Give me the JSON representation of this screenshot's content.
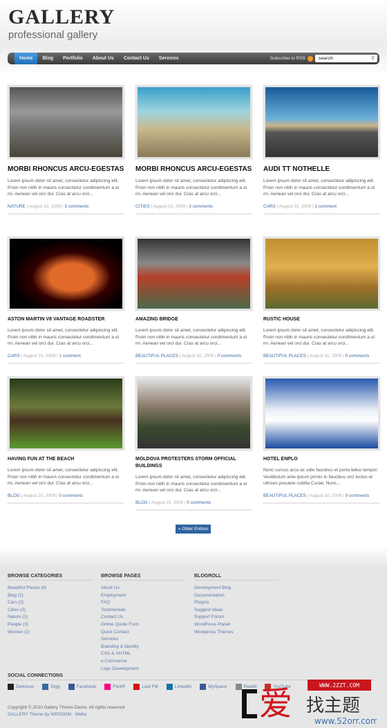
{
  "header": {
    "logo": "GALLERY",
    "tagline": "professional gallery"
  },
  "nav": {
    "items": [
      "Home",
      "Blog",
      "Portfolio",
      "About Us",
      "Contact Us",
      "Services"
    ],
    "active": "Home",
    "subscribe": "Subscribe to RSS",
    "search_placeholder": "search"
  },
  "posts": [
    {
      "title": "MORBI RHONCUS ARCU-EGESTAS",
      "excerpt": "Lorem ipsum dolor sit amet, consectetur adipiscing elit. Proin non nibh in mauris consectetur condimentum a ut mi. Aenean vel orci dui. Cras at arcu orci...",
      "category": "NATURE",
      "date": "August 10, 2009",
      "comments": "5 comments"
    },
    {
      "title": "MORBI RHONCUS ARCU-EGESTAS",
      "excerpt": "Lorem ipsum dolor sit amet, consectetur adipiscing elit. Proin non nibh in mauris consectetur condimentum a ut mi. Aenean vel orci dui. Cras at arcu orci...",
      "category": "CITIES",
      "date": "August 10, 2009",
      "comments": "3 comments"
    },
    {
      "title": "AUDI TT NOTHELLE",
      "excerpt": "Lorem ipsum dolor sit amet, consectetur adipiscing elit. Proin non nibh in mauris consectetur condimentum a ut mi. Aenean vel orci dui. Cras at arcu orci...",
      "category": "CARS",
      "date": "August 10, 2009",
      "comments": "1 comment"
    },
    {
      "title": "ASTON MARTIN V8 VANTAGE ROADSTER",
      "excerpt": "Lorem ipsum dolor sit amet, consectetur adipiscing elit. Proin non nibh in mauris consectetur condimentum a ut mi. Aenean vel orci dui. Cras at arcu orci...",
      "category": "CARS",
      "date": "August 10, 2009",
      "comments": "1 comment"
    },
    {
      "title": "AMAZING BRIDGE",
      "excerpt": "Lorem ipsum dolor sit amet, consectetur adipiscing elit. Proin non nibh in mauris consectetur condimentum a ut mi. Aenean vel orci dui. Cras at arcu orci...",
      "category": "BEAUTIFUL PLACES",
      "date": "August 10, 2009",
      "comments": "0 comments"
    },
    {
      "title": "RUSTIC HOUSE",
      "excerpt": "Lorem ipsum dolor sit amet, consectetur adipiscing elit. Proin non nibh in mauris consectetur condimentum a ut mi. Aenean vel orci dui. Cras at arcu orci...",
      "category": "BEAUTIFUL PLACES",
      "date": "August 10, 2009",
      "comments": "0 comments"
    },
    {
      "title": "HAVING FUN AT THE BEACH",
      "excerpt": "Lorem ipsum dolor sit amet, consectetur adipiscing elit. Proin non nibh in mauris consectetur condimentum a ut mi. Aenean vel orci dui. Cras at arcu orci...",
      "category": "BLOG",
      "date": "August 10, 2009",
      "comments": "0 comments"
    },
    {
      "title": "MOLDOVA PROTESTERS STORM OFFICIAL BUILDINGS",
      "excerpt": "Lorem ipsum dolor sit amet, consectetur adipiscing elit. Proin non nibh in mauris consectetur condimentum a ut mi. Aenean vel orci dui. Cras at arcu orci...",
      "category": "BLOG",
      "date": "August 10, 2009",
      "comments": "0 comments"
    },
    {
      "title": "HOTEL ENPLO",
      "excerpt": "Nunc cursus arcu ac odio faucibus et porta tellus tempor. Vestibulum ante ipsum primis in faucibus orci luctus et ultrices posuere cubilia Curae; Nunc...",
      "category": "BEAUTIFUL PLACES",
      "date": "August 10, 2009",
      "comments": "0 comments"
    }
  ],
  "older": "« Older Entries",
  "footer": {
    "categories": {
      "title": "BROWSE CATEGORIES",
      "items": [
        "Beautiful Places (6)",
        "Blog (2)",
        "Cars (2)",
        "Cities (3)",
        "Nature (1)",
        "People (3)",
        "Women (2)"
      ]
    },
    "pages": {
      "title": "BROWSE PAGES",
      "items": [
        "About Us",
        "Employment",
        "FAQ",
        "Testimonials",
        "Contact Us",
        "Online Quote Form",
        "Quick Contact",
        "Services",
        "Branding & Identity",
        "CSS & XHTML",
        "e-Commerce",
        "Logo Development"
      ]
    },
    "blogroll": {
      "title": "BLOGROLL",
      "items": [
        "Development Blog",
        "Documentation",
        "Plugins",
        "Suggest Ideas",
        "Support Forum",
        "WordPress Planet",
        "Wordpress Themes"
      ]
    },
    "social": {
      "title": "SOCIAL CONNECTIONS",
      "items": [
        "Delicious",
        "Digg",
        "Facebook",
        "FlickR",
        "Last FM",
        "LinkedIn",
        "MySpace",
        "Reddit",
        "YouTube"
      ]
    },
    "copyright": "Copyright © 2010 Gallery Theme Demo. All rights reserved",
    "credit": "GALLERY Theme by WPZOOM . Webo"
  },
  "watermark": {
    "url": "WWW.2ZZT.COM",
    "text": "爱找主题",
    "url2": "www.52orr.com"
  }
}
